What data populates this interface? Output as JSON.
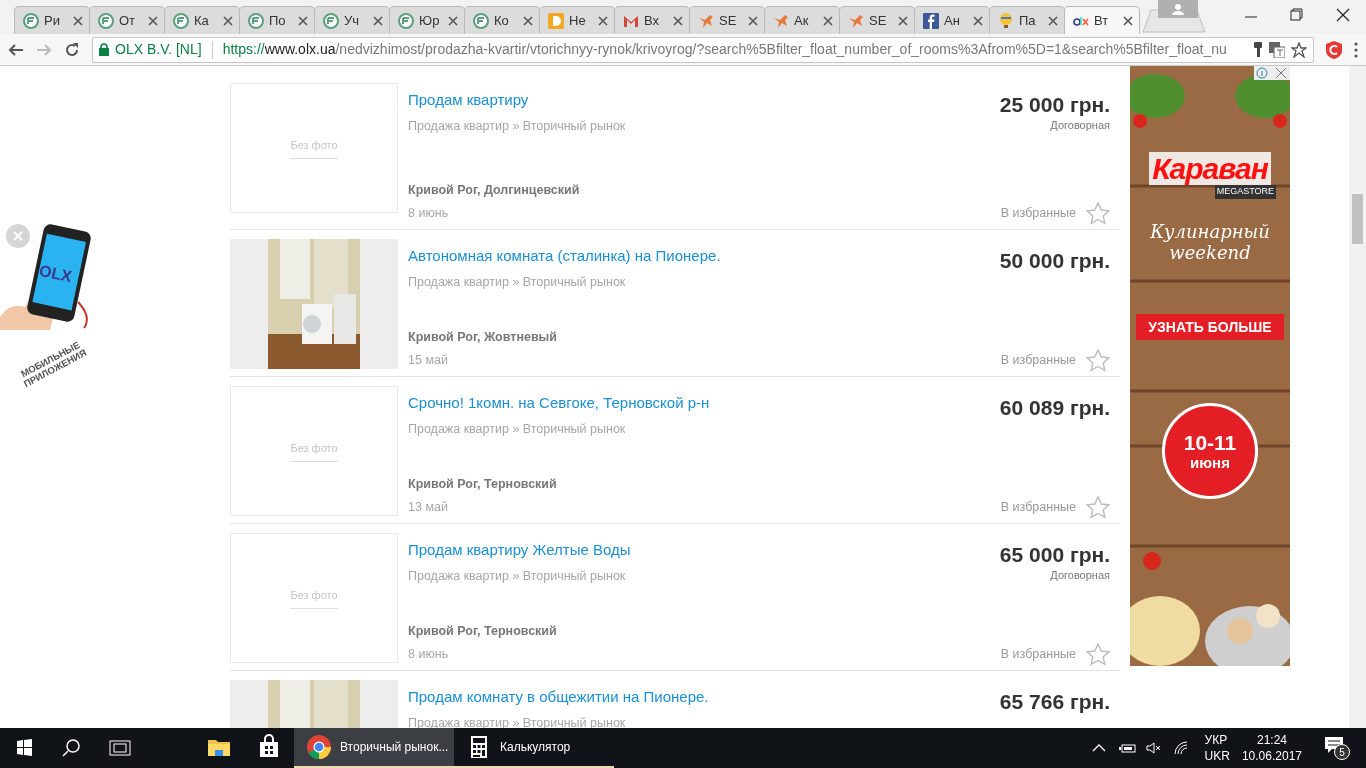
{
  "browser": {
    "tabs": [
      {
        "title": "Ри",
        "kind": "green",
        "selected": false
      },
      {
        "title": "От",
        "kind": "green",
        "selected": false
      },
      {
        "title": "Ка",
        "kind": "green",
        "selected": false
      },
      {
        "title": "По",
        "kind": "green",
        "selected": false
      },
      {
        "title": "Уч",
        "kind": "green",
        "selected": false
      },
      {
        "title": "Юр",
        "kind": "green",
        "selected": false
      },
      {
        "title": "Ко",
        "kind": "green",
        "selected": false
      },
      {
        "title": "Не",
        "kind": "d",
        "selected": false
      },
      {
        "title": "Вх",
        "kind": "mail",
        "selected": false
      },
      {
        "title": "SE",
        "kind": "bird",
        "selected": false
      },
      {
        "title": "Ак",
        "kind": "bird",
        "selected": false
      },
      {
        "title": "SE",
        "kind": "bird",
        "selected": false
      },
      {
        "title": "Ан",
        "kind": "fb",
        "selected": false
      },
      {
        "title": "Па",
        "kind": "balloon",
        "selected": false
      },
      {
        "title": "Вт",
        "kind": "olx",
        "selected": true
      }
    ],
    "site_identity": "OLX B.V. [NL]",
    "url_scheme": "https://",
    "url_host": "www.olx.ua",
    "url_path": "/nedvizhimost/prodazha-kvartir/vtorichnyy-rynok/krivoyrog/?search%5Bfilter_float_number_of_rooms%3Afrom%5D=1&search%5Bfilter_float_nu"
  },
  "app_promo": {
    "caption": "МОБИЛЬНЫЕ ПРИЛОЖЕНИЯ",
    "logo": "OLX"
  },
  "listings": [
    {
      "title": "Продам квартиру",
      "category": "Продажа квартир » Вторичный рынок",
      "location": "Кривой Рог, Долгинцевский",
      "date": "8 июнь",
      "price": "25 000 грн.",
      "negotiable": "Договорная",
      "favorite": "В избранные",
      "photo": false,
      "no_photo": "Без фото"
    },
    {
      "title": "Автономная комната (сталинка) на Пионере.",
      "category": "Продажа квартир » Вторичный рынок",
      "location": "Кривой Рог, Жовтневый",
      "date": "15 май",
      "price": "50 000 грн.",
      "favorite": "В избранные",
      "photo": true
    },
    {
      "title": "Срочно! 1комн. на Севгоке, Терновской р-н",
      "category": "Продажа квартир » Вторичный рынок",
      "location": "Кривой Рог, Терновский",
      "date": "13 май",
      "price": "60 089 грн.",
      "favorite": "В избранные",
      "photo": false,
      "no_photo": "Без фото"
    },
    {
      "title": "Продам квартиру Желтые Воды",
      "category": "Продажа квартир » Вторичный рынок",
      "location": "Кривой Рог, Терновский",
      "date": "8 июнь",
      "price": "65 000 грн.",
      "negotiable": "Договорная",
      "favorite": "В избранные",
      "photo": false,
      "no_photo": "Без фото"
    },
    {
      "title": "Продам комнату в общежитии на Пионере.",
      "category": "Продажа квартир » Вторичный рынок",
      "price": "65 766 грн.",
      "photo": true
    }
  ],
  "ad": {
    "brand": "Караван",
    "brand_sub": "MEGASTORE",
    "tagline": "Кулинарный weekend",
    "cta": "УЗНАТЬ БОЛЬШЕ",
    "dates": "10-11",
    "month": "июня"
  },
  "taskbar": {
    "apps": [
      {
        "kind": "explorer",
        "selected": false
      },
      {
        "kind": "store",
        "selected": false
      },
      {
        "kind": "chrome",
        "label": "Вторичный рынок...",
        "selected": true
      },
      {
        "kind": "calc",
        "label": "Калькулятор",
        "selected": false
      }
    ],
    "lang_top": "УКР",
    "lang_bottom": "UKR",
    "time": "21:24",
    "date": "10.06.2017",
    "notifications": "5"
  }
}
